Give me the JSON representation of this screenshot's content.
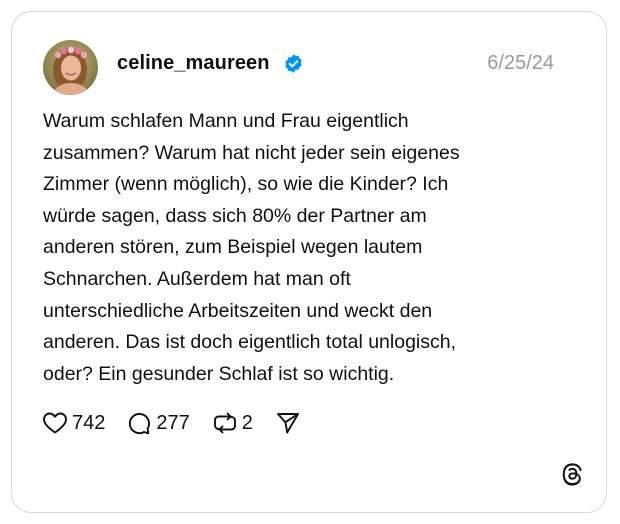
{
  "post": {
    "username": "celine_maureen",
    "date": "6/25/24",
    "text": "Warum schlafen Mann und Frau eigentlich\nzusammen? Warum hat nicht jeder sein eigenes\nZimmer (wenn möglich), so wie die Kinder? Ich\nwürde sagen, dass sich 80% der Partner am\nanderen stören, zum Beispiel wegen lautem\nSchnarchen. Außerdem hat man oft\nunterschiedliche Arbeitszeiten und weckt den\nanderen. Das ist doch eigentlich total unlogisch,\noder? Ein gesunder Schlaf ist so wichtig."
  },
  "actions": {
    "likes": "742",
    "replies": "277",
    "reposts": "2"
  },
  "icons": {
    "verified": "verified-badge-icon",
    "like": "heart-icon",
    "reply": "comment-bubble-icon",
    "repost": "repost-icon",
    "share": "send-icon",
    "brand": "threads-logo-icon"
  },
  "colors": {
    "verified_blue": "#0095f6",
    "text": "#101010",
    "muted": "#999999",
    "border": "#d9d9d9"
  }
}
